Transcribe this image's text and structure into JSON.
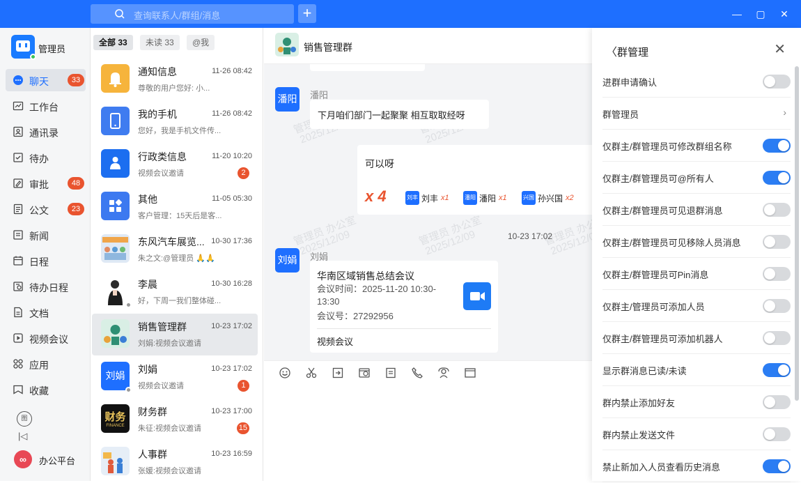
{
  "colors": {
    "primary": "#1e6fff",
    "badge": "#e9542f",
    "toggle_on": "#2b7df3"
  },
  "topbar": {
    "search_placeholder": "查询联系人/群组/消息",
    "add": "+",
    "min": "—",
    "max": "▢",
    "close": "✕"
  },
  "nav": {
    "user": "管理员",
    "items": [
      {
        "label": "聊天",
        "badge": "33",
        "icon": "chat-icon"
      },
      {
        "label": "工作台",
        "badge": "",
        "icon": "workbench-icon"
      },
      {
        "label": "通讯录",
        "badge": "",
        "icon": "contacts-icon"
      },
      {
        "label": "待办",
        "badge": "",
        "icon": "todo-icon"
      },
      {
        "label": "审批",
        "badge": "48",
        "icon": "approval-icon"
      },
      {
        "label": "公文",
        "badge": "23",
        "icon": "document-icon"
      },
      {
        "label": "新闻",
        "badge": "",
        "icon": "news-icon"
      },
      {
        "label": "日程",
        "badge": "",
        "icon": "calendar-icon"
      },
      {
        "label": "待办日程",
        "badge": "",
        "icon": "todo-calendar-icon"
      },
      {
        "label": "文档",
        "badge": "",
        "icon": "docs-icon"
      },
      {
        "label": "视频会议",
        "badge": "",
        "icon": "video-icon"
      },
      {
        "label": "应用",
        "badge": "",
        "icon": "apps-icon"
      },
      {
        "label": "收藏",
        "badge": "",
        "icon": "favorite-icon"
      }
    ],
    "bottom_icon": "图",
    "collapse": "|◁",
    "platform": "办公平台",
    "platform_logo": "∞"
  },
  "tabs": {
    "all": "全部 33",
    "unread": "未读 33",
    "at": "@我"
  },
  "conversations": [
    {
      "name": "通知信息",
      "time": "11-26 08:42",
      "msg": "尊敬的用户您好: 小...",
      "badge": ""
    },
    {
      "name": "我的手机",
      "time": "11-26 08:42",
      "msg": "您好，我是手机文件传...",
      "badge": ""
    },
    {
      "name": "行政类信息",
      "time": "11-20 10:20",
      "msg": "视频会议邀请",
      "badge": "2"
    },
    {
      "name": "其他",
      "time": "11-05 05:30",
      "msg": "客户管理：15天后是客...",
      "badge": ""
    },
    {
      "name": "东风汽车展览...",
      "time": "10-30 17:36",
      "msg": "朱之文:@管理员 🙏🙏",
      "badge": ""
    },
    {
      "name": "李晨",
      "time": "10-30 16:28",
      "msg": "好，下周一我们整体碰...",
      "badge": ""
    },
    {
      "name": "销售管理群",
      "time": "10-23 17:02",
      "msg": "刘娟:视频会议邀请",
      "badge": ""
    },
    {
      "name": "刘娟",
      "time": "10-23 17:02",
      "msg": "视频会议邀请",
      "badge": "1",
      "avatar_text": "刘娟"
    },
    {
      "name": "财务群",
      "time": "10-23 17:00",
      "msg": "朱征:视频会议邀请",
      "badge": "15",
      "avatar_text": "财务",
      "avatar_sub": "FINANCE"
    },
    {
      "name": "人事群",
      "time": "10-23 16:59",
      "msg": "张媛:视频会议邀请",
      "badge": ""
    }
  ],
  "chat": {
    "title": "销售管理群",
    "msg1": {
      "sender": "潘阳",
      "avatar": "潘阳",
      "text": "下月咱们部门一起聚聚 相互取取经呀"
    },
    "msg2": {
      "text": "可以呀",
      "count": "x 4",
      "reactors": [
        {
          "av": "刘丰",
          "name": "刘丰",
          "n": "x1"
        },
        {
          "av": "潘阳",
          "name": "潘阳",
          "n": "x1"
        },
        {
          "av": "兴国",
          "name": "孙兴国",
          "n": "x2"
        }
      ]
    },
    "timestamp": "10-23 17:02",
    "msg3": {
      "sender": "刘娟",
      "avatar": "刘娟",
      "title": "华南区域销售总结会议",
      "time_label": "会议时间：",
      "time": "2025-11-20 10:30-13:30",
      "id_label": "会议号：",
      "id": "27292956",
      "footer": "视频会议"
    },
    "watermark1": "管理员 办公室",
    "watermark2": "2025/12/09"
  },
  "panel": {
    "title": "群管理",
    "back": "〈",
    "close": "✕",
    "rows": [
      {
        "label": "进群申请确认",
        "type": "toggle",
        "on": false
      },
      {
        "label": "群管理员",
        "type": "link",
        "on": false
      },
      {
        "label": "仅群主/群管理员可修改群组名称",
        "type": "toggle",
        "on": true
      },
      {
        "label": "仅群主/群管理员可@所有人",
        "type": "toggle",
        "on": true
      },
      {
        "label": "仅群主/群管理员可见退群消息",
        "type": "toggle",
        "on": false
      },
      {
        "label": "仅群主/群管理员可见移除人员消息",
        "type": "toggle",
        "on": false
      },
      {
        "label": "仅群主/群管理员可Pin消息",
        "type": "toggle",
        "on": false
      },
      {
        "label": "仅群主/管理员可添加人员",
        "type": "toggle",
        "on": false
      },
      {
        "label": "仅群主/群管理员可添加机器人",
        "type": "toggle",
        "on": false
      },
      {
        "label": "显示群消息已读/未读",
        "type": "toggle",
        "on": true
      },
      {
        "label": "群内禁止添加好友",
        "type": "toggle",
        "on": false
      },
      {
        "label": "群内禁止发送文件",
        "type": "toggle",
        "on": false
      },
      {
        "label": "禁止新加入人员查看历史消息",
        "type": "toggle",
        "on": true
      }
    ]
  }
}
